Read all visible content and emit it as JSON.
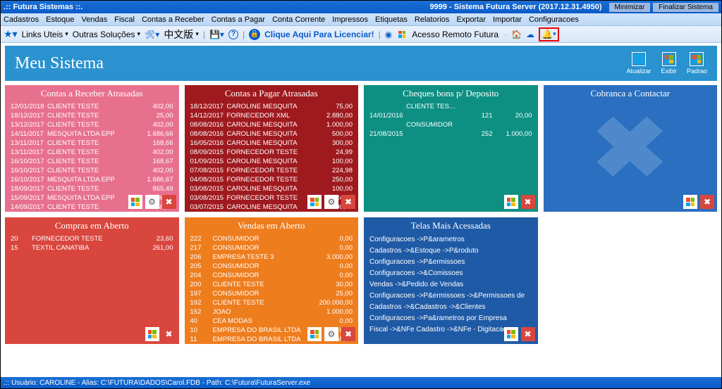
{
  "window": {
    "title_left": ".:: Futura Sistemas ::.",
    "title_right": "9999 - Sistema Futura Server (2017.12.31.4950)",
    "btn_min": "Minimizar",
    "btn_close": "Finalizar Sistema"
  },
  "menu": [
    "Cadastros",
    "Estoque",
    "Vendas",
    "Fiscal",
    "Contas a Receber",
    "Contas a Pagar",
    "Conta Corrente",
    "Impressos",
    "Etiquetas",
    "Relatorios",
    "Exportar",
    "Importar",
    "Configuracoes"
  ],
  "toolbar": {
    "links": "Links Uteis",
    "solucoes": "Outras Soluções",
    "chinese": "中文版",
    "license": "Clique Aqui Para Licenciar!",
    "remote": "Acesso Remoto Futura"
  },
  "dash": {
    "title": "Meu Sistema",
    "actions": {
      "refresh": "Atualizar",
      "show": "Exibir",
      "default": "Padrao"
    }
  },
  "cards": {
    "receber": {
      "title": "Contas a Receber Atrasadas",
      "rows": [
        [
          "12/01/2018",
          "CLIENTE TESTE",
          "402,00"
        ],
        [
          "18/12/2017",
          "CLIENTE TESTE",
          "25,00"
        ],
        [
          "13/12/2017",
          "CLIENTE TESTE",
          "402,00"
        ],
        [
          "14/11/2017",
          "MESQUITA LTDA EPP",
          "1.686,66"
        ],
        [
          "13/11/2017",
          "CLIENTE TESTE",
          "168,66"
        ],
        [
          "13/11/2017",
          "CLIENTE TESTE",
          "402,00"
        ],
        [
          "16/10/2017",
          "CLIENTE TESTE",
          "168,67"
        ],
        [
          "16/10/2017",
          "CLIENTE TESTE",
          "402,00"
        ],
        [
          "16/10/2017",
          "MESQUITA LTDA EPP",
          "1.686,67"
        ],
        [
          "18/09/2017",
          "CLIENTE TESTE",
          "865,49"
        ],
        [
          "15/09/2017",
          "MESQUITA LTDA EPP",
          "1.686,67"
        ],
        [
          "14/09/2017",
          "CLIENTE TESTE",
          "168,67"
        ]
      ]
    },
    "pagar": {
      "title": "Contas a Pagar Atrasadas",
      "rows": [
        [
          "18/12/2017",
          "CAROLINE MESQUITA",
          "75,00"
        ],
        [
          "14/12/2017",
          "FORNECEDOR XML",
          "2.880,00"
        ],
        [
          "08/08/2016",
          "CAROLINE MESQUITA",
          "1.000,00"
        ],
        [
          "08/08/2016",
          "CAROLINE MESQUITA",
          "500,00"
        ],
        [
          "16/05/2016",
          "CAROLINE MESQUITA",
          "300,00"
        ],
        [
          "08/09/2015",
          "FORNECEDOR TESTE",
          "24,99"
        ],
        [
          "01/09/2015",
          "CAROLINE MESQUITA",
          "100,00"
        ],
        [
          "07/08/2015",
          "FORNECEDOR TESTE",
          "224,98"
        ],
        [
          "04/08/2015",
          "FORNECEDOR TESTE",
          "250,00"
        ],
        [
          "03/08/2015",
          "CAROLINE MESQUITA",
          "100,00"
        ],
        [
          "03/08/2015",
          "FORNECEDOR TESTE",
          "224,98"
        ],
        [
          "03/07/2015",
          "CAROLINE MESQUITA",
          "100,00"
        ]
      ]
    },
    "cheques": {
      "title": "Cheques bons p/ Deposito",
      "rows": [
        [
          "",
          "CLIENTE TESTE",
          "",
          ""
        ],
        [
          "14/01/2016",
          "",
          "121",
          "20,00"
        ],
        [
          "",
          "CONSUMIDOR",
          "",
          ""
        ],
        [
          "21/08/2015",
          "",
          "252",
          "1.000,00"
        ]
      ]
    },
    "cobranca": {
      "title": "Cobranca a Contactar"
    },
    "compras": {
      "title": "Compras em Aberto",
      "rows": [
        [
          "20",
          "FORNECEDOR TESTE",
          "23,60"
        ],
        [
          "15",
          "TEXTIL CANATIBA",
          "261,00"
        ]
      ]
    },
    "vendas": {
      "title": "Vendas em Aberto",
      "rows": [
        [
          "222",
          "CONSUMIDOR",
          "0,00"
        ],
        [
          "217",
          "CONSUMIDOR",
          "0,00"
        ],
        [
          "206",
          "EMPRESA TESTE 3",
          "3.000,00"
        ],
        [
          "205",
          "CONSUMIDOR",
          "0,00"
        ],
        [
          "204",
          "CONSUMIDOR",
          "0,00"
        ],
        [
          "200",
          "CLIENTE TESTE",
          "30,00"
        ],
        [
          "197",
          "CONSUMIDOR",
          "25,00"
        ],
        [
          "192",
          "CLIENTE TESTE",
          "200.000,00"
        ],
        [
          "152",
          "JOAO",
          "1.000,00"
        ],
        [
          "40",
          "CEA MODAS",
          "0,00"
        ],
        [
          "10",
          "EMPRESA DO BRASIL LTDA",
          "0,00"
        ],
        [
          "11",
          "EMPRESA DO BRASIL LTDA",
          "350,00"
        ]
      ]
    },
    "telas": {
      "title": "Telas Mais Acessadas",
      "items": [
        "Configuracoes ->P&arametros",
        "Cadastros ->&Estoque ->P&roduto",
        "Configuracoes ->P&ermissoes",
        "Configuracoes ->&Comissoes",
        "Vendas ->&Pedido de Vendas",
        "Configuracoes ->P&ermissoes ->&Permissoes de",
        "Cadastros ->&Cadastros ->&Clientes",
        "Configuracoes ->Pa&rametros por Empresa",
        "Fiscal ->&NFe Cadastro ->&NFe - Digitacao"
      ]
    }
  },
  "status": ".:: Usuário: CAROLINE  - Alias: C:\\FUTURA\\DADOS\\Carol.FDB - Path: C:\\Futura\\FuturaServer.exe"
}
